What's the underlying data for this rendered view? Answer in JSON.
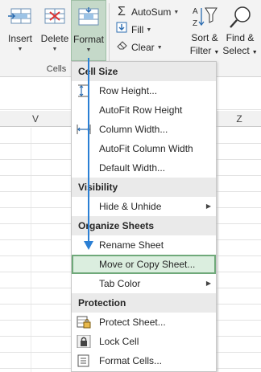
{
  "ribbon": {
    "insert_label": "Insert",
    "delete_label": "Delete",
    "format_label": "Format",
    "group_label": "Cells",
    "autosum_label": "AutoSum",
    "fill_label": "Fill",
    "clear_label": "Clear",
    "sort_label_1": "Sort &",
    "sort_label_2": "Filter",
    "find_label_1": "Find &",
    "find_label_2": "Select"
  },
  "columns": {
    "v": "V",
    "z": "Z"
  },
  "menu": {
    "sections": {
      "cell_size": "Cell Size",
      "visibility": "Visibility",
      "organize": "Organize Sheets",
      "protection": "Protection"
    },
    "items": {
      "row_height": "Row Height...",
      "autofit_row": "AutoFit Row Height",
      "column_width": "Column Width...",
      "autofit_column": "AutoFit Column Width",
      "default_width": "Default Width...",
      "hide_unhide": "Hide & Unhide",
      "rename_sheet": "Rename Sheet",
      "move_copy": "Move or Copy Sheet...",
      "tab_color": "Tab Color",
      "protect_sheet": "Protect Sheet...",
      "lock_cell": "Lock Cell",
      "format_cells": "Format Cells..."
    }
  },
  "colors": {
    "highlight_bg": "#dbeedf",
    "highlight_border": "#6fa97a",
    "format_button_bg": "#c5d9c9",
    "callout_arrow": "#2b7fd4"
  }
}
